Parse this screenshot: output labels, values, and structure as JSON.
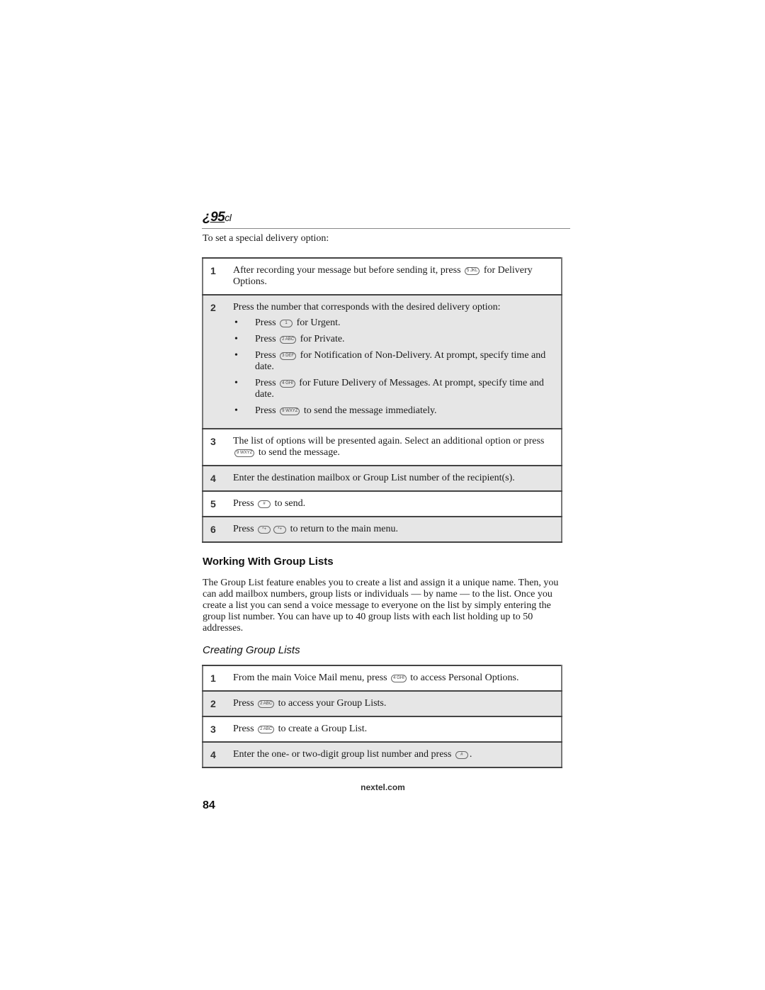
{
  "header": {
    "logo_prefix": "¿",
    "logo_model": "95",
    "logo_suffix": "cl"
  },
  "intro": "To set a special delivery option:",
  "delivery_steps": [
    {
      "num": "1",
      "text_before": "After recording your message but before sending it, press",
      "key": "5 JKL",
      "text_after": "for Delivery Options."
    },
    {
      "num": "2",
      "text": "Press the number that corresponds with the desired delivery option:",
      "bullets": [
        {
          "before": "Press",
          "key": "1",
          "after": "for Urgent."
        },
        {
          "before": "Press",
          "key": "2 ABC",
          "after": "for Private."
        },
        {
          "before": "Press",
          "key": "3 DEF",
          "after": "for Notification of Non-Delivery. At prompt, specify time and date."
        },
        {
          "before": "Press",
          "key": "4 GHI",
          "after": "for Future Delivery of Messages. At prompt, specify time and date."
        },
        {
          "before": "Press",
          "key": "9 WXYZ",
          "after": "to send the message immediately."
        }
      ]
    },
    {
      "num": "3",
      "text_before": "The list of options will be presented again. Select an additional option or press",
      "key": "9 WXYZ",
      "text_after": "to send the message."
    },
    {
      "num": "4",
      "text": "Enter the destination mailbox or Group List number of the recipient(s)."
    },
    {
      "num": "5",
      "text_before": "Press",
      "key": "#",
      "text_after": "to send."
    },
    {
      "num": "6",
      "text_before": "Press",
      "key": "*+",
      "key2": "*+",
      "text_after": "to return to the main menu."
    }
  ],
  "section_title": "Working With Group Lists",
  "section_body": "The Group List feature enables you to create a list and assign it a unique name. Then, you can add mailbox numbers, group lists or individuals — by name — to the list. Once you create a list you can send a voice message to everyone on the list by simply entering the group list number. You can have up to 40 group lists with each list holding up to 50 addresses.",
  "subsection_title": "Creating Group Lists",
  "group_steps": [
    {
      "num": "1",
      "text_before": "From the main Voice Mail menu, press",
      "key": "4 GHI",
      "text_after": "to access Personal Options."
    },
    {
      "num": "2",
      "text_before": "Press",
      "key": "2 ABC",
      "text_after": "to access your Group Lists."
    },
    {
      "num": "3",
      "text_before": "Press",
      "key": "2 ABC",
      "text_after": "to create a Group List."
    },
    {
      "num": "4",
      "text_before": "Enter the one- or two-digit group list number and press",
      "key": "#",
      "text_after": "."
    }
  ],
  "footer": {
    "url": "nextel.com",
    "page_number": "84"
  }
}
